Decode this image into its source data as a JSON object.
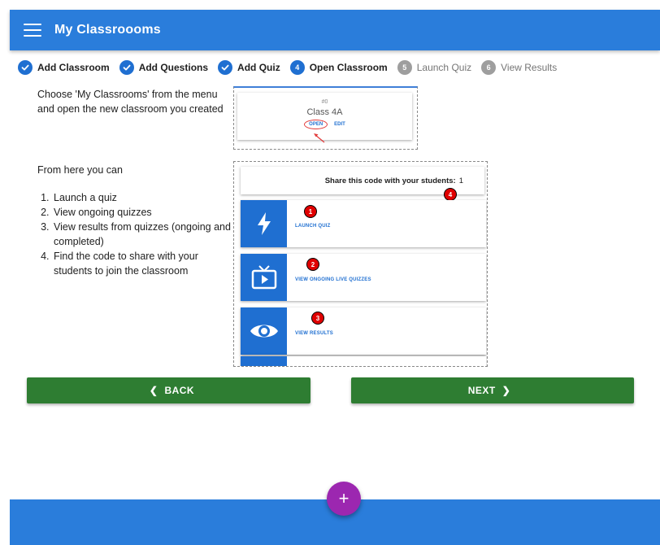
{
  "app": {
    "title": "My Classroooms"
  },
  "stepper": [
    {
      "label": "Add Classroom",
      "state": "done",
      "marker": ""
    },
    {
      "label": "Add Questions",
      "state": "done",
      "marker": ""
    },
    {
      "label": "Add Quiz",
      "state": "done",
      "marker": ""
    },
    {
      "label": "Open Classroom",
      "state": "active",
      "marker": "4"
    },
    {
      "label": "Launch Quiz",
      "state": "todo",
      "marker": "5"
    },
    {
      "label": "View Results",
      "state": "todo",
      "marker": "6"
    }
  ],
  "instructions": {
    "open_classroom": "Choose 'My Classrooms' from the menu and open the new classroom you created",
    "intro": "From here you can",
    "items": [
      "Launch a quiz",
      "View ongoing quizzes",
      "View results from quizzes (ongoing and completed)",
      "Find the code to share with your students to join the classroom"
    ]
  },
  "classroom_card": {
    "number": "#0",
    "name": "Class 4A",
    "open_label": "OPEN",
    "edit_label": "EDIT"
  },
  "classroom_view": {
    "share_label": "Share this code with your students:",
    "share_code": "1",
    "share_badge": "4",
    "rows": [
      {
        "label": "LAUNCH QUIZ",
        "badge": "1",
        "icon": "lightning-icon"
      },
      {
        "label": "VIEW ONGOING LIVE QUIZZES",
        "badge": "2",
        "icon": "tv-play-icon"
      },
      {
        "label": "VIEW RESULTS",
        "badge": "3",
        "icon": "eye-icon"
      }
    ]
  },
  "nav": {
    "back_label": "BACK",
    "next_label": "NEXT"
  },
  "fab": {
    "label": "+"
  },
  "colors": {
    "primary": "#2a7ddb",
    "step": "#1f6fd1",
    "nav_green": "#2e7d32",
    "fab": "#9c27b0",
    "badge": "#e00000"
  }
}
